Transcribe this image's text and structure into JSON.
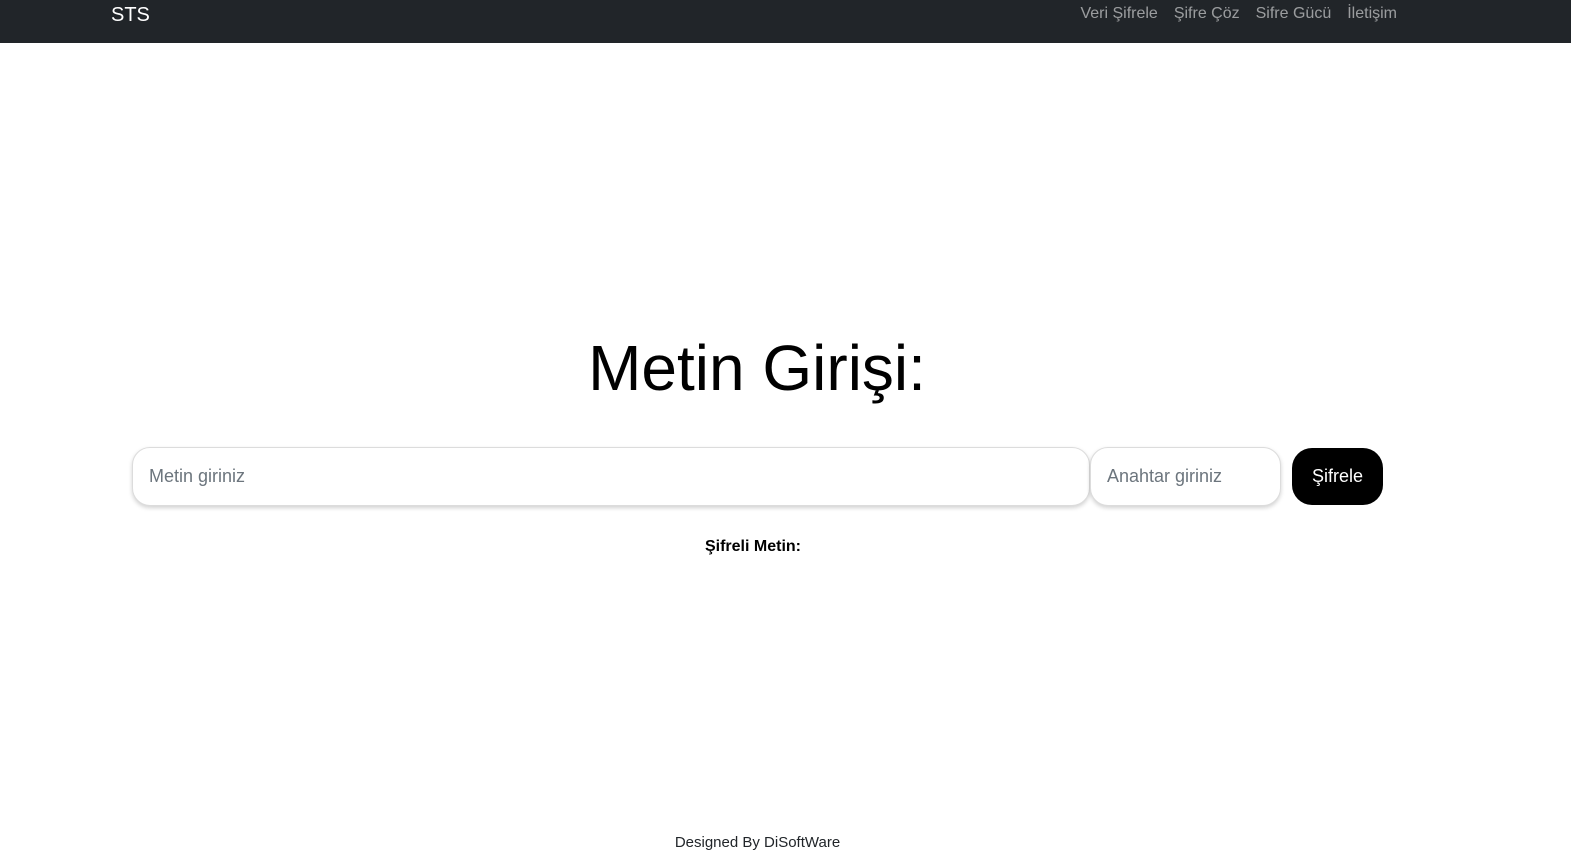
{
  "navbar": {
    "brand": "STS",
    "links": [
      "Veri Şifrele",
      "Şifre Çöz",
      "Sifre Gücü",
      "İletişim"
    ]
  },
  "main": {
    "title": "Metin Girişi:",
    "text_input": {
      "placeholder": "Metin giriniz",
      "value": ""
    },
    "key_input": {
      "placeholder": "Anahtar giriniz",
      "value": ""
    },
    "submit_label": "Şifrele",
    "result_label": "Şifreli Metin:"
  },
  "footer": {
    "text": "Designed By DiSoftWare"
  },
  "colors": {
    "navbar_bg": "#212529",
    "button_bg": "#000000"
  }
}
